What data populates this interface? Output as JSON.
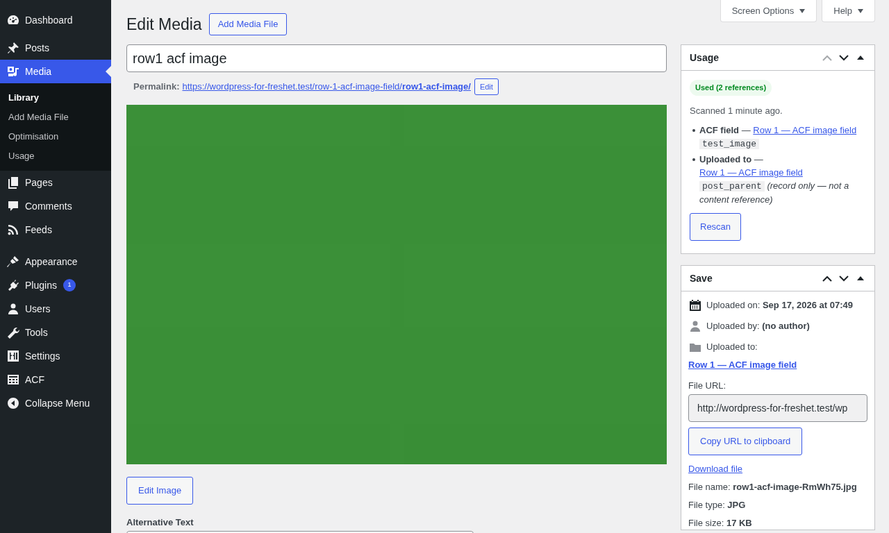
{
  "sidebar": {
    "items": [
      {
        "label": "Dashboard",
        "selected": false
      },
      {
        "label": "Posts",
        "selected": false
      },
      {
        "label": "Media",
        "selected": true,
        "children": [
          {
            "label": "Library",
            "selected": true
          },
          {
            "label": "Add Media File",
            "selected": false
          },
          {
            "label": "Optimisation",
            "selected": false
          },
          {
            "label": "Usage",
            "selected": false
          }
        ]
      },
      {
        "label": "Pages",
        "selected": false
      },
      {
        "label": "Comments",
        "selected": false
      },
      {
        "label": "Feeds",
        "selected": false
      },
      {
        "label": "Appearance",
        "selected": false
      },
      {
        "label": "Plugins",
        "selected": false,
        "badge": "1"
      },
      {
        "label": "Users",
        "selected": false
      },
      {
        "label": "Tools",
        "selected": false
      },
      {
        "label": "Settings",
        "selected": false
      },
      {
        "label": "ACF",
        "selected": false
      },
      {
        "label": "Collapse Menu",
        "selected": false
      }
    ]
  },
  "top_buttons": [
    "Screen Options",
    "Help"
  ],
  "title": "Edit Media",
  "add_button": "Add Media File",
  "title_field": {
    "value": "row1 acf image"
  },
  "permalink": {
    "label": "Permalink:",
    "url": "https://wordpress-for-freshet.test/row-1-acf-image-field/**row1-acf-image/**",
    "edit": "Edit"
  },
  "image": {
    "kind": "picture"
  },
  "edit_image_button": "Edit Image",
  "alt_text": {
    "label": "Alternative Text"
  },
  "usage_box": {
    "title": "Usage",
    "badge": "Used (2 references)",
    "scanned": "Scanned 1 minute ago.",
    "references": [
      {
        "type": "ACF field",
        "separator": "—",
        "link": "Row 1 — ACF image field",
        "code": "test_image"
      },
      {
        "type": "Uploaded to",
        "separator": "—",
        "link": "Row 1 — ACF image field",
        "code": "post_parent",
        "note": "(record only — not a content reference)"
      }
    ],
    "button": "Rescan"
  },
  "save_box": {
    "title": "Save",
    "uploaded_on": {
      "label": "Uploaded on:",
      "value": "Sep 17, 2026 at 07:49"
    },
    "uploaded_by": {
      "label": "Uploaded by:",
      "value": "(no author)"
    },
    "uploaded_to": {
      "label": "Uploaded to:",
      "link": "Row 1 — ACF image field"
    },
    "file_url": {
      "label": "File URL:",
      "value": "http://wordpress-for-freshet.test/wp"
    },
    "copy_button": "Copy URL to clipboard",
    "download": "Download file",
    "details": [
      {
        "label": "File name:",
        "value": "row1-acf-image-RmWh75.jpg"
      },
      {
        "label": "File type:",
        "value": "JPG"
      },
      {
        "label": "File size:",
        "value": "17 KB"
      }
    ]
  }
}
